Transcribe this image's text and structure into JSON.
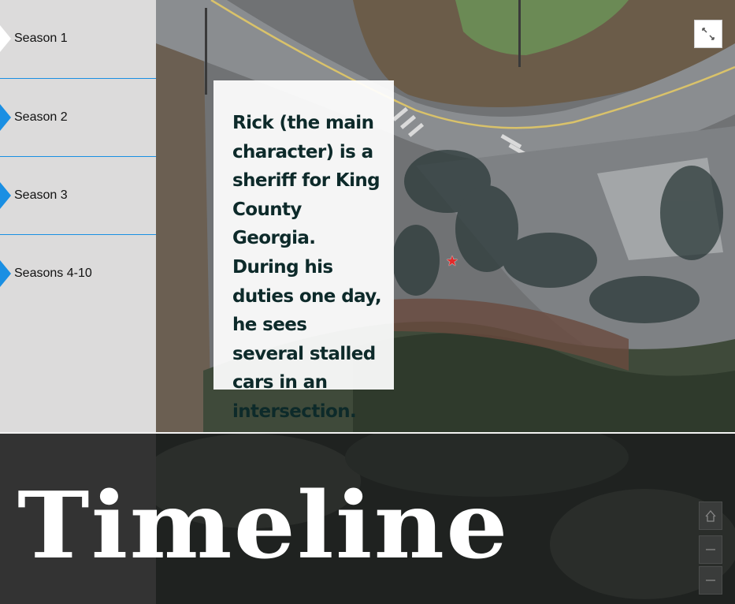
{
  "sidebar": {
    "items": [
      {
        "label": "Season 1",
        "active": true
      },
      {
        "label": "Season 2",
        "active": false
      },
      {
        "label": "Season 3",
        "active": false
      },
      {
        "label": "Seasons 4-10",
        "active": false
      }
    ],
    "accent_color": "#1a8fe3"
  },
  "story": {
    "text": "Rick (the main character) is a sheriff for King County Georgia. During his duties one day, he sees several stalled cars in an intersection."
  },
  "map": {
    "marker_icon": "star-pin-icon",
    "marker_color": "#e32a2a"
  },
  "title": {
    "text": "Timeline"
  },
  "controls": {
    "home_icon": "home-icon",
    "zoom_in_icon": "minus-line-icon",
    "zoom_out_icon": "minus-line-icon"
  }
}
